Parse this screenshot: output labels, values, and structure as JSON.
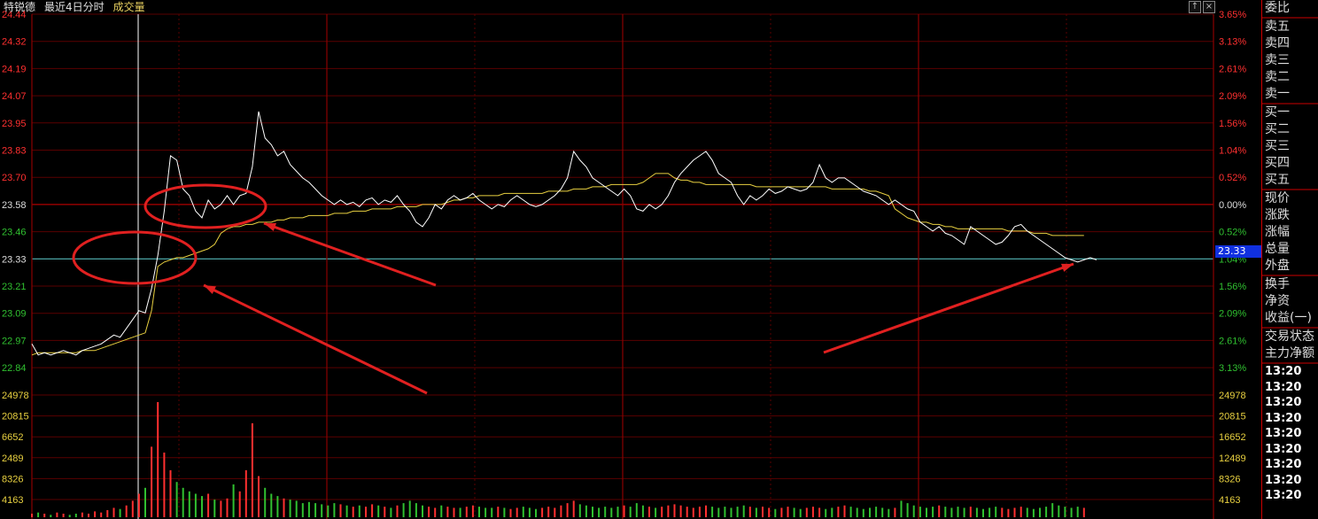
{
  "header": {
    "stock_name": "特锐德",
    "mode_label": "最近4日分时",
    "volume_label": "成交量",
    "btn_up": "↑",
    "btn_close": "×"
  },
  "price_axis": {
    "left_labels": [
      "24.44",
      "24.32",
      "24.19",
      "24.07",
      "23.95",
      "23.83",
      "23.70",
      "23.58",
      "23.46",
      "23.33",
      "23.21",
      "23.09",
      "22.97",
      "22.84"
    ],
    "right_labels": [
      "3.65%",
      "3.13%",
      "2.61%",
      "2.09%",
      "1.56%",
      "1.04%",
      "0.52%",
      "0.00%",
      "0.52%",
      "1.04%",
      "1.56%",
      "2.09%",
      "2.61%",
      "3.13%"
    ],
    "current_price": "23.33",
    "colors": {
      "up": "#ff3030",
      "down": "#30c030",
      "neutral": "#dddddd"
    }
  },
  "volume_axis": {
    "left_labels": [
      "24978",
      "20815",
      "6652",
      "2489",
      "8326",
      "4163"
    ],
    "right_labels": [
      "24978",
      "20815",
      "16652",
      "12489",
      "8326",
      "4163"
    ]
  },
  "chart_data": {
    "type": "line",
    "days": 4,
    "prev_close": 23.58,
    "ylim": [
      22.72,
      24.44
    ],
    "series": [
      {
        "values": [
          22.95,
          22.9,
          22.91,
          22.9,
          22.91,
          22.92,
          22.91,
          22.9,
          22.92,
          22.93,
          22.94,
          22.95,
          22.97,
          22.99,
          22.98,
          23.02,
          23.06,
          23.1,
          23.09,
          23.2,
          23.35,
          23.55,
          23.8,
          23.78,
          23.65,
          23.62,
          23.55,
          23.52,
          23.6,
          23.56,
          23.58,
          23.62,
          23.58,
          23.62,
          23.63,
          23.75,
          24.0,
          23.88,
          23.85,
          23.8,
          23.82,
          23.76,
          23.73,
          23.7,
          23.68,
          23.65,
          23.62,
          23.6,
          23.58,
          23.6,
          23.58,
          23.59,
          23.57,
          23.6,
          23.61,
          23.58,
          23.6,
          23.59,
          23.62,
          23.58,
          23.55,
          23.5,
          23.48,
          23.52,
          23.58,
          23.56,
          23.6,
          23.62,
          23.6,
          23.61,
          23.63,
          23.6,
          23.58,
          23.56,
          23.58,
          23.57,
          23.6,
          23.62,
          23.6,
          23.58,
          23.57,
          23.58,
          23.6,
          23.62,
          23.65,
          23.7,
          23.82,
          23.78,
          23.75,
          23.7,
          23.68,
          23.66,
          23.64,
          23.62,
          23.65,
          23.62,
          23.56,
          23.55,
          23.58,
          23.56,
          23.58,
          23.62,
          23.68,
          23.72,
          23.75,
          23.78,
          23.8,
          23.82,
          23.78,
          23.72,
          23.7,
          23.68,
          23.62,
          23.58,
          23.62,
          23.6,
          23.62,
          23.65,
          23.63,
          23.64,
          23.66,
          23.65,
          23.64,
          23.65,
          23.68,
          23.76,
          23.7,
          23.68,
          23.7,
          23.7,
          23.68,
          23.66,
          23.64,
          23.63,
          23.62,
          23.6,
          23.58,
          23.6,
          23.58,
          23.56,
          23.55,
          23.5,
          23.48,
          23.46,
          23.48,
          23.45,
          23.44,
          23.42,
          23.4,
          23.48,
          23.46,
          23.44,
          23.42,
          23.4,
          23.41,
          23.44,
          23.48,
          23.49,
          23.46,
          23.44,
          23.42,
          23.4,
          23.38,
          23.36,
          23.34,
          23.33,
          23.32,
          23.33,
          23.34,
          23.33
        ]
      },
      {
        "values": [
          22.9,
          22.91,
          22.91,
          22.91,
          22.91,
          22.91,
          22.91,
          22.91,
          22.92,
          22.92,
          22.92,
          22.93,
          22.94,
          22.95,
          22.96,
          22.97,
          22.98,
          22.99,
          23.0,
          23.1,
          23.3,
          23.32,
          23.33,
          23.34,
          23.34,
          23.35,
          23.36,
          23.37,
          23.38,
          23.4,
          23.45,
          23.47,
          23.48,
          23.48,
          23.49,
          23.49,
          23.5,
          23.5,
          23.5,
          23.51,
          23.51,
          23.52,
          23.52,
          23.52,
          23.53,
          23.53,
          23.53,
          23.53,
          23.54,
          23.54,
          23.54,
          23.55,
          23.55,
          23.55,
          23.56,
          23.56,
          23.56,
          23.56,
          23.57,
          23.57,
          23.57,
          23.57,
          23.58,
          23.58,
          23.58,
          23.58,
          23.59,
          23.6,
          23.6,
          23.61,
          23.61,
          23.62,
          23.62,
          23.62,
          23.62,
          23.63,
          23.63,
          23.63,
          23.63,
          23.63,
          23.63,
          23.63,
          23.64,
          23.64,
          23.64,
          23.64,
          23.65,
          23.65,
          23.65,
          23.66,
          23.66,
          23.66,
          23.67,
          23.67,
          23.67,
          23.67,
          23.67,
          23.68,
          23.7,
          23.72,
          23.72,
          23.72,
          23.7,
          23.69,
          23.69,
          23.68,
          23.68,
          23.67,
          23.67,
          23.67,
          23.67,
          23.67,
          23.67,
          23.67,
          23.67,
          23.66,
          23.66,
          23.66,
          23.66,
          23.66,
          23.66,
          23.66,
          23.66,
          23.66,
          23.66,
          23.66,
          23.66,
          23.65,
          23.65,
          23.65,
          23.65,
          23.65,
          23.65,
          23.64,
          23.64,
          23.63,
          23.62,
          23.56,
          23.54,
          23.52,
          23.51,
          23.5,
          23.5,
          23.49,
          23.49,
          23.48,
          23.48,
          23.47,
          23.47,
          23.47,
          23.47,
          23.47,
          23.47,
          23.47,
          23.47,
          23.46,
          23.46,
          23.46,
          23.46,
          23.45,
          23.45,
          23.45,
          23.44,
          23.44,
          23.44,
          23.44,
          23.44,
          23.44
        ]
      }
    ],
    "volume": [
      3,
      4,
      3,
      2,
      4,
      3,
      2,
      3,
      4,
      3,
      5,
      4,
      6,
      8,
      7,
      10,
      14,
      20,
      25,
      60,
      98,
      55,
      40,
      30,
      25,
      22,
      20,
      18,
      20,
      15,
      14,
      16,
      28,
      22,
      40,
      80,
      35,
      25,
      20,
      18,
      16,
      15,
      14,
      12,
      13,
      12,
      11,
      10,
      12,
      11,
      10,
      9,
      10,
      9,
      11,
      10,
      9,
      8,
      10,
      12,
      14,
      12,
      10,
      9,
      8,
      10,
      9,
      8,
      8,
      9,
      10,
      9,
      8,
      8,
      9,
      8,
      7,
      8,
      9,
      8,
      7,
      8,
      9,
      8,
      10,
      12,
      14,
      11,
      10,
      9,
      8,
      9,
      8,
      9,
      10,
      9,
      12,
      10,
      9,
      8,
      9,
      10,
      11,
      10,
      9,
      8,
      9,
      10,
      9,
      8,
      9,
      8,
      9,
      10,
      9,
      8,
      9,
      8,
      7,
      8,
      9,
      8,
      7,
      8,
      9,
      8,
      7,
      8,
      9,
      10,
      9,
      8,
      7,
      8,
      9,
      8,
      7,
      8,
      14,
      12,
      10,
      9,
      8,
      9,
      10,
      9,
      8,
      9,
      8,
      9,
      8,
      7,
      8,
      9,
      8,
      7,
      8,
      9,
      8,
      7,
      8,
      9,
      12,
      10,
      9,
      8,
      9,
      8
    ]
  },
  "annotations": {
    "circles": 3,
    "arrows": 3
  },
  "panel": {
    "rows1": [
      "委比"
    ],
    "rows2": [
      "卖五",
      "卖四",
      "卖三",
      "卖二",
      "卖一"
    ],
    "rows3": [
      "买一",
      "买二",
      "买三",
      "买四",
      "买五"
    ],
    "rows4": [
      "现价",
      "涨跌",
      "涨幅",
      "总量",
      "外盘"
    ],
    "rows5": [
      "换手",
      "净资",
      "收益(一)"
    ],
    "rows6": [
      "交易状态"
    ],
    "rows7": [
      "主力净额"
    ],
    "times": [
      "13:20",
      "13:20",
      "13:20",
      "13:20",
      "13:20",
      "13:20",
      "13:20",
      "13:20",
      "13:20"
    ]
  }
}
